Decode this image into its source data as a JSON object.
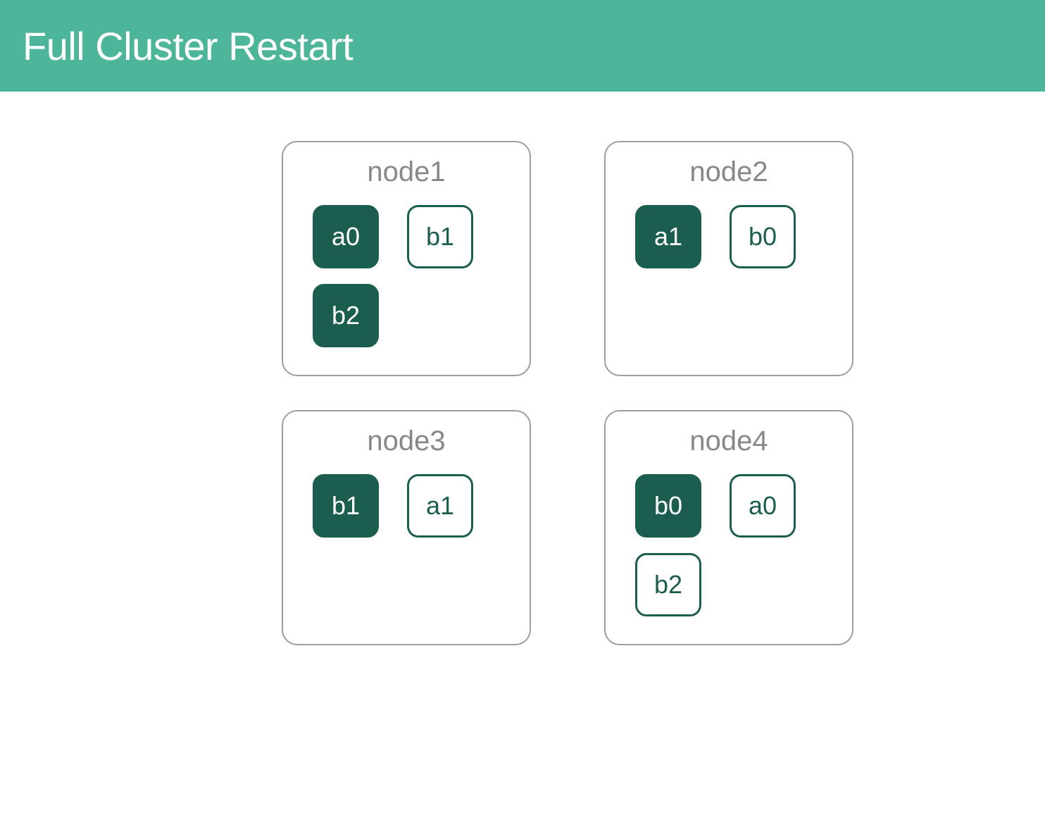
{
  "header": {
    "title": "Full Cluster Restart"
  },
  "nodes": [
    {
      "name": "node1",
      "shards": [
        {
          "label": "a0",
          "type": "primary"
        },
        {
          "label": "b1",
          "type": "replica"
        },
        {
          "label": "b2",
          "type": "primary"
        }
      ]
    },
    {
      "name": "node2",
      "shards": [
        {
          "label": "a1",
          "type": "primary"
        },
        {
          "label": "b0",
          "type": "replica"
        }
      ]
    },
    {
      "name": "node3",
      "shards": [
        {
          "label": "b1",
          "type": "primary"
        },
        {
          "label": "a1",
          "type": "replica"
        }
      ]
    },
    {
      "name": "node4",
      "shards": [
        {
          "label": "b0",
          "type": "primary"
        },
        {
          "label": "a0",
          "type": "replica"
        },
        {
          "label": "b2",
          "type": "replica"
        }
      ]
    }
  ],
  "colors": {
    "header_bg": "#4db59a",
    "primary_shard_bg": "#1b5e50",
    "node_border": "#9e9e9e"
  }
}
